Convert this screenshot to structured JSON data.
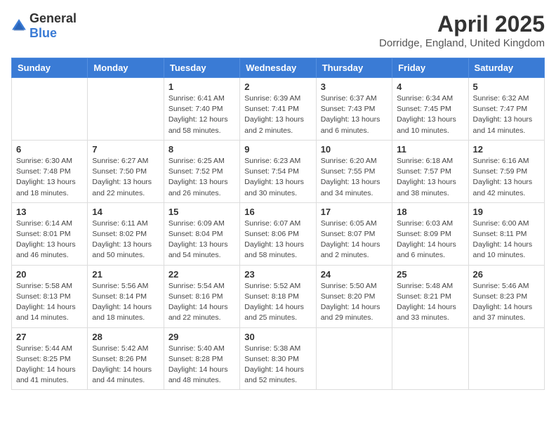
{
  "logo": {
    "general": "General",
    "blue": "Blue"
  },
  "title": "April 2025",
  "subtitle": "Dorridge, England, United Kingdom",
  "days_of_week": [
    "Sunday",
    "Monday",
    "Tuesday",
    "Wednesday",
    "Thursday",
    "Friday",
    "Saturday"
  ],
  "weeks": [
    [
      {
        "day": "",
        "info": ""
      },
      {
        "day": "",
        "info": ""
      },
      {
        "day": "1",
        "info": "Sunrise: 6:41 AM\nSunset: 7:40 PM\nDaylight: 12 hours and 58 minutes."
      },
      {
        "day": "2",
        "info": "Sunrise: 6:39 AM\nSunset: 7:41 PM\nDaylight: 13 hours and 2 minutes."
      },
      {
        "day": "3",
        "info": "Sunrise: 6:37 AM\nSunset: 7:43 PM\nDaylight: 13 hours and 6 minutes."
      },
      {
        "day": "4",
        "info": "Sunrise: 6:34 AM\nSunset: 7:45 PM\nDaylight: 13 hours and 10 minutes."
      },
      {
        "day": "5",
        "info": "Sunrise: 6:32 AM\nSunset: 7:47 PM\nDaylight: 13 hours and 14 minutes."
      }
    ],
    [
      {
        "day": "6",
        "info": "Sunrise: 6:30 AM\nSunset: 7:48 PM\nDaylight: 13 hours and 18 minutes."
      },
      {
        "day": "7",
        "info": "Sunrise: 6:27 AM\nSunset: 7:50 PM\nDaylight: 13 hours and 22 minutes."
      },
      {
        "day": "8",
        "info": "Sunrise: 6:25 AM\nSunset: 7:52 PM\nDaylight: 13 hours and 26 minutes."
      },
      {
        "day": "9",
        "info": "Sunrise: 6:23 AM\nSunset: 7:54 PM\nDaylight: 13 hours and 30 minutes."
      },
      {
        "day": "10",
        "info": "Sunrise: 6:20 AM\nSunset: 7:55 PM\nDaylight: 13 hours and 34 minutes."
      },
      {
        "day": "11",
        "info": "Sunrise: 6:18 AM\nSunset: 7:57 PM\nDaylight: 13 hours and 38 minutes."
      },
      {
        "day": "12",
        "info": "Sunrise: 6:16 AM\nSunset: 7:59 PM\nDaylight: 13 hours and 42 minutes."
      }
    ],
    [
      {
        "day": "13",
        "info": "Sunrise: 6:14 AM\nSunset: 8:01 PM\nDaylight: 13 hours and 46 minutes."
      },
      {
        "day": "14",
        "info": "Sunrise: 6:11 AM\nSunset: 8:02 PM\nDaylight: 13 hours and 50 minutes."
      },
      {
        "day": "15",
        "info": "Sunrise: 6:09 AM\nSunset: 8:04 PM\nDaylight: 13 hours and 54 minutes."
      },
      {
        "day": "16",
        "info": "Sunrise: 6:07 AM\nSunset: 8:06 PM\nDaylight: 13 hours and 58 minutes."
      },
      {
        "day": "17",
        "info": "Sunrise: 6:05 AM\nSunset: 8:07 PM\nDaylight: 14 hours and 2 minutes."
      },
      {
        "day": "18",
        "info": "Sunrise: 6:03 AM\nSunset: 8:09 PM\nDaylight: 14 hours and 6 minutes."
      },
      {
        "day": "19",
        "info": "Sunrise: 6:00 AM\nSunset: 8:11 PM\nDaylight: 14 hours and 10 minutes."
      }
    ],
    [
      {
        "day": "20",
        "info": "Sunrise: 5:58 AM\nSunset: 8:13 PM\nDaylight: 14 hours and 14 minutes."
      },
      {
        "day": "21",
        "info": "Sunrise: 5:56 AM\nSunset: 8:14 PM\nDaylight: 14 hours and 18 minutes."
      },
      {
        "day": "22",
        "info": "Sunrise: 5:54 AM\nSunset: 8:16 PM\nDaylight: 14 hours and 22 minutes."
      },
      {
        "day": "23",
        "info": "Sunrise: 5:52 AM\nSunset: 8:18 PM\nDaylight: 14 hours and 25 minutes."
      },
      {
        "day": "24",
        "info": "Sunrise: 5:50 AM\nSunset: 8:20 PM\nDaylight: 14 hours and 29 minutes."
      },
      {
        "day": "25",
        "info": "Sunrise: 5:48 AM\nSunset: 8:21 PM\nDaylight: 14 hours and 33 minutes."
      },
      {
        "day": "26",
        "info": "Sunrise: 5:46 AM\nSunset: 8:23 PM\nDaylight: 14 hours and 37 minutes."
      }
    ],
    [
      {
        "day": "27",
        "info": "Sunrise: 5:44 AM\nSunset: 8:25 PM\nDaylight: 14 hours and 41 minutes."
      },
      {
        "day": "28",
        "info": "Sunrise: 5:42 AM\nSunset: 8:26 PM\nDaylight: 14 hours and 44 minutes."
      },
      {
        "day": "29",
        "info": "Sunrise: 5:40 AM\nSunset: 8:28 PM\nDaylight: 14 hours and 48 minutes."
      },
      {
        "day": "30",
        "info": "Sunrise: 5:38 AM\nSunset: 8:30 PM\nDaylight: 14 hours and 52 minutes."
      },
      {
        "day": "",
        "info": ""
      },
      {
        "day": "",
        "info": ""
      },
      {
        "day": "",
        "info": ""
      }
    ]
  ]
}
